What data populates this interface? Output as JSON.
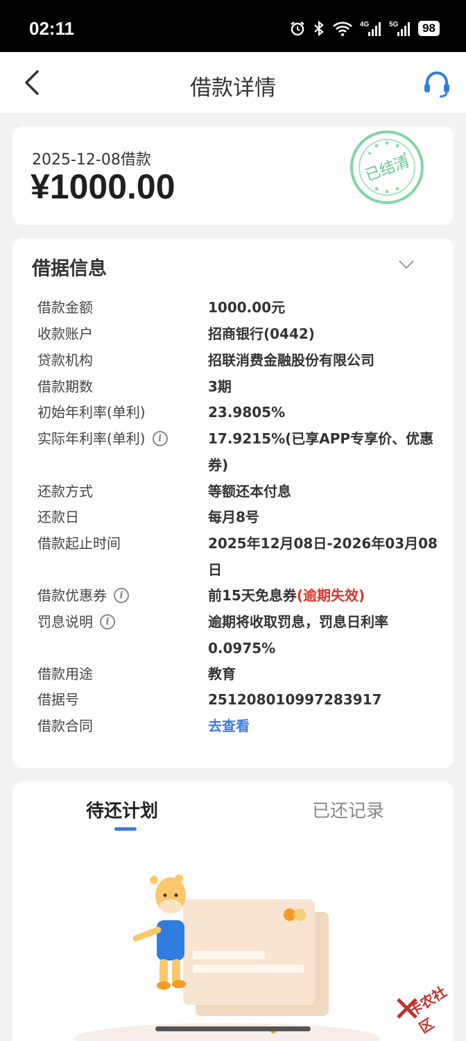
{
  "status_bar": {
    "time": "02:11",
    "network_1": "4G",
    "network_2": "5G",
    "battery": "98"
  },
  "nav": {
    "title": "借款详情"
  },
  "summary": {
    "date_label": "2025-12-08借款",
    "amount": "¥1000.00",
    "stamp_text": "已结清"
  },
  "info": {
    "title": "借据信息",
    "rows": [
      {
        "label": "借款金额",
        "value": "1000.00元"
      },
      {
        "label": "收款账户",
        "value": "招商银行(0442)"
      },
      {
        "label": "贷款机构",
        "value": "招联消费金融股份有限公司"
      },
      {
        "label": "借款期数",
        "value": "3期"
      },
      {
        "label": "初始年利率(单利)",
        "value": "23.9805%"
      },
      {
        "label": "实际年利率(单利)",
        "value": "17.9215%(已享APP专享价、优惠券)"
      },
      {
        "label": "还款方式",
        "value": "等额还本付息"
      },
      {
        "label": "还款日",
        "value": "每月8号"
      },
      {
        "label": "借款起止时间",
        "value": "2025年12月08日-2026年03月08日"
      },
      {
        "label": "借款优惠券",
        "value": "前15天免息券",
        "value_note": "(逾期失效)"
      },
      {
        "label": "罚息说明",
        "value": "逾期将收取罚息，罚息日利率0.0975%"
      },
      {
        "label": "借款用途",
        "value": "教育"
      },
      {
        "label": "借据号",
        "value": "251208010997283917"
      },
      {
        "label": "借款合同",
        "value": "去查看"
      }
    ]
  },
  "plan": {
    "tab_active": "待还计划",
    "tab_inactive": "已还记录"
  },
  "watermark": "卡农社区",
  "colors": {
    "accent": "#3a7be2",
    "warning": "#d9362b",
    "stamp": "#3cbf7a"
  }
}
